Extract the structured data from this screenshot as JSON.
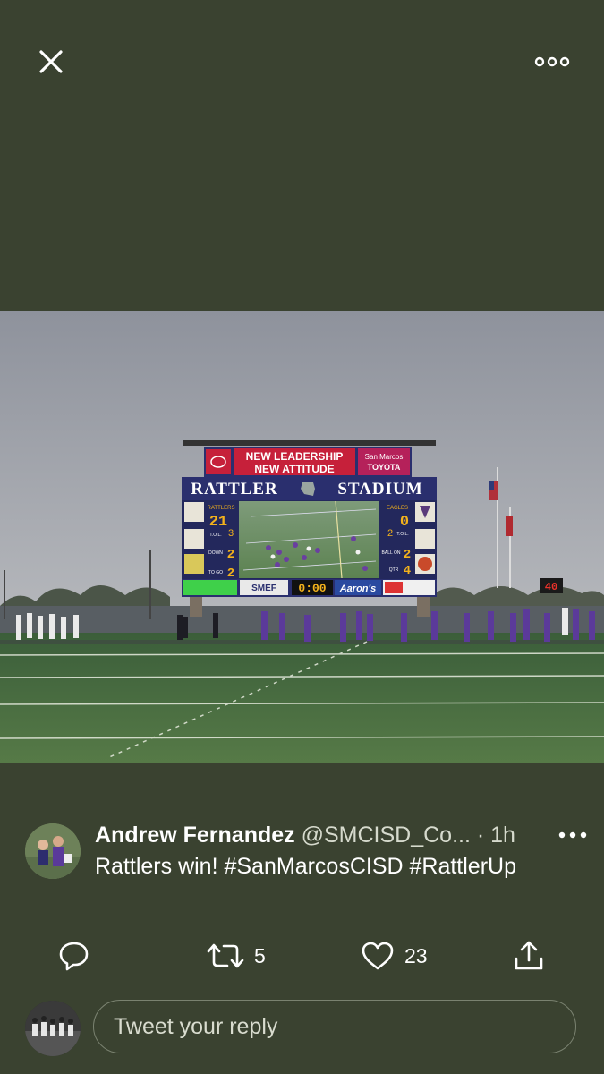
{
  "tweet": {
    "author_name": "Andrew Fernandez",
    "handle": "@SMCISD_Co...",
    "separator": "·",
    "time": "1h",
    "text": "Rattlers win! #SanMarcosCISD #RattlerUp"
  },
  "photo": {
    "board_sponsor_line1": "NEW LEADERSHIP",
    "board_sponsor_line2": "NEW ATTITUDE",
    "board_sponsor_right1": "San Marcos",
    "board_sponsor_right2": "TOYOTA",
    "stadium_name_left": "RATTLER",
    "stadium_name_right": "STADIUM",
    "home_team": "RATTLERS",
    "home_score": "21",
    "away_team": "EAGLES",
    "away_score": "0",
    "clock": "0:00",
    "down_label": "DOWN",
    "ball_on_label": "BALL ON",
    "qtr_label": "QTR",
    "tol_label": "T.O.L.",
    "to_go_label": "TO GO",
    "down_value": "2",
    "to_go_value": "2",
    "ball_on_value": "2",
    "qtr_value": "4",
    "home_tol": "3",
    "away_tol": "2",
    "smef_label": "SMEF",
    "aarons_label": "Aaron's",
    "play_clock": "40"
  },
  "actions": {
    "retweet_count": "5",
    "like_count": "23"
  },
  "reply": {
    "placeholder": "Tweet your reply"
  },
  "colors": {
    "background": "#3a4230",
    "scoreboard": "#2a2f6e",
    "accent_red": "#c6203a",
    "score_yellow": "#f3b21c"
  }
}
